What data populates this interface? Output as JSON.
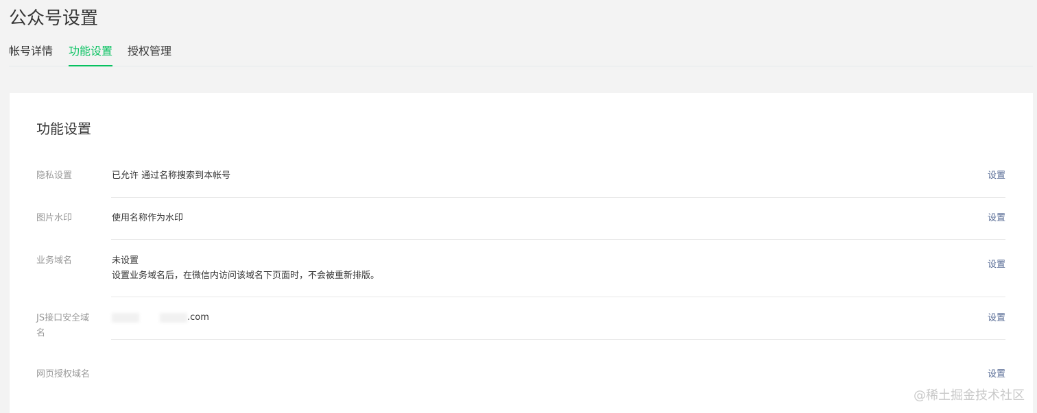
{
  "page": {
    "title": "公众号设置"
  },
  "tabs": [
    {
      "label": "帐号详情",
      "active": false
    },
    {
      "label": "功能设置",
      "active": true
    },
    {
      "label": "授权管理",
      "active": false
    }
  ],
  "card": {
    "title": "功能设置",
    "rows": [
      {
        "label": "隐私设置",
        "value_lines": [
          "已允许 通过名称搜索到本帐号"
        ],
        "action": "设置"
      },
      {
        "label": "图片水印",
        "value_lines": [
          "使用名称作为水印"
        ],
        "action": "设置"
      },
      {
        "label": "业务域名",
        "value_lines": [
          "未设置",
          "设置业务域名后，在微信内访问该域名下页面时，不会被重新排版。"
        ],
        "action": "设置"
      },
      {
        "label": "JS接口安全域名",
        "value_suffix": ".com",
        "action": "设置"
      },
      {
        "label": "网页授权域名",
        "action": "设置"
      }
    ]
  },
  "colors": {
    "accent": "#07c160",
    "link": "#576b95"
  },
  "watermark": "@稀土掘金技术社区"
}
